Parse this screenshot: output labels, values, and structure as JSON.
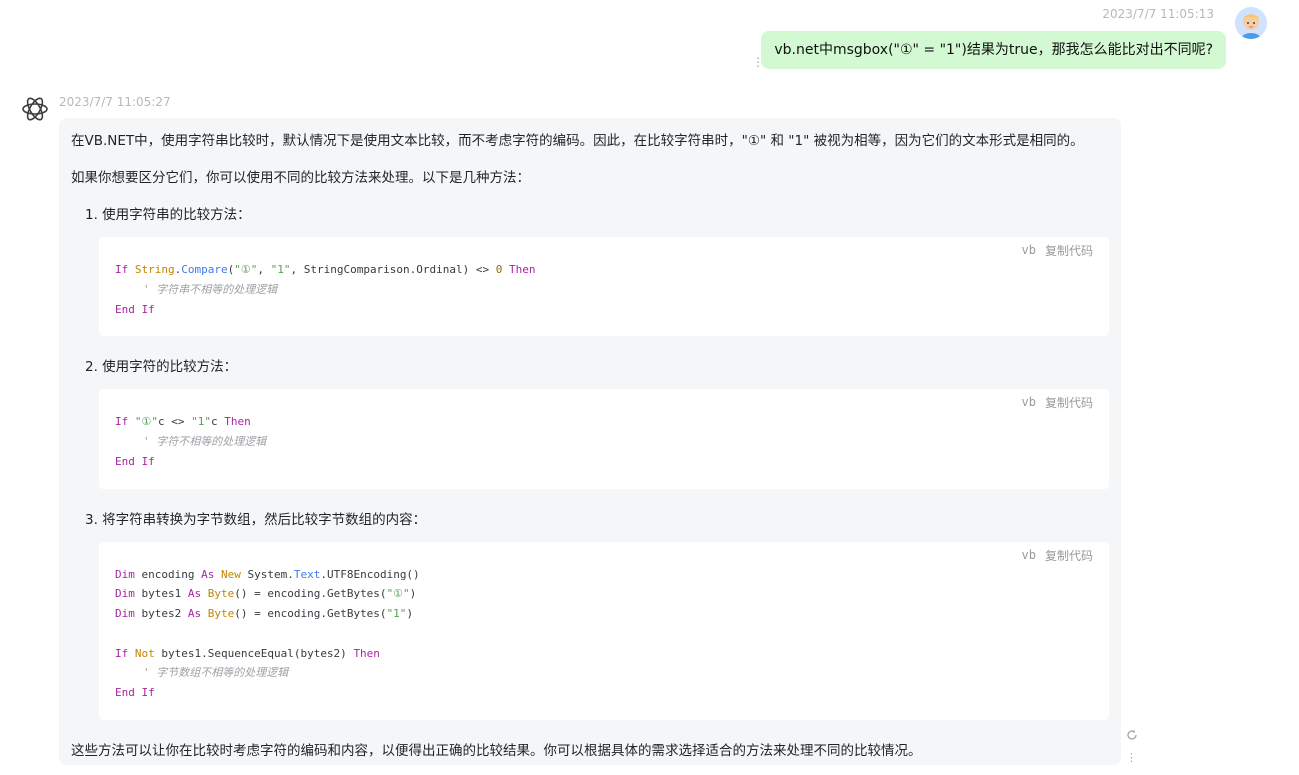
{
  "user_message": {
    "timestamp": "2023/7/7 11:05:13",
    "text": "vb.net中msgbox(\"①\" = \"1\")结果为true，那我怎么能比对出不同呢?"
  },
  "assistant_message": {
    "timestamp": "2023/7/7 11:05:27",
    "intro": "在VB.NET中，使用字符串比较时，默认情况下是使用文本比较，而不考虑字符的编码。因此，在比较字符串时，\"①\" 和 \"1\" 被视为相等，因为它们的文本形式是相同的。",
    "lead": "如果你想要区分它们，你可以使用不同的比较方法来处理。以下是几种方法：",
    "items": [
      "1. 使用字符串的比较方法：",
      "2. 使用字符的比较方法：",
      "3. 将字符串转换为字节数组，然后比较字节数组的内容："
    ],
    "code_lang": "vb",
    "copy_label": "复制代码",
    "code1": {
      "l1_kw": "If",
      "l1_ty": "String",
      "l1_fn": "Compare",
      "l1_a": "(",
      "l1_s1": "\"①\"",
      "l1_b": ", ",
      "l1_s2": "\"1\"",
      "l1_c": ", StringComparison.Ordinal) <> ",
      "l1_n": "0",
      "l1_then": "Then",
      "l2": "' 字符串不相等的处理逻辑",
      "l3": "End If"
    },
    "code2": {
      "l1_kw": "If",
      "l1_s1": "\"①\"",
      "l1_a": "c <> ",
      "l1_s2": "\"1\"",
      "l1_b": "c ",
      "l1_then": "Then",
      "l2": "' 字符不相等的处理逻辑",
      "l3": "End If"
    },
    "code3": {
      "l1_dim": "Dim",
      "l1_a": " encoding ",
      "l1_as": "As",
      "l1_new": "New",
      "l1_b": " System.",
      "l1_text": "Text",
      "l1_c": ".UTF8Encoding()",
      "l2_dim": "Dim",
      "l2_a": " bytes1 ",
      "l2_as": "As",
      "l2_byte": "Byte",
      "l2_b": "() = encoding.GetBytes(",
      "l2_s": "\"①\"",
      "l2_c": ")",
      "l3_dim": "Dim",
      "l3_a": " bytes2 ",
      "l3_as": "As",
      "l3_byte": "Byte",
      "l3_b": "() = encoding.GetBytes(",
      "l3_s": "\"1\"",
      "l3_c": ")",
      "l4_if": "If",
      "l4_not": "Not",
      "l4_a": " bytes1.SequenceEqual(bytes2) ",
      "l4_then": "Then",
      "l5": "' 字节数组不相等的处理逻辑",
      "l6": "End If"
    },
    "outro": "这些方法可以让你在比较时考虑字符的编码和内容，以便得出正确的比较结果。你可以根据具体的需求选择适合的方法来处理不同的比较情况。"
  },
  "colors": {
    "user_bubble": "#d2f9d1",
    "assistant_bubble": "#f4f6f8",
    "keyword": "#a626a4",
    "type": "#c18401",
    "string": "#50a14f",
    "comment": "#a0a1a7"
  },
  "icons": [
    "user-avatar-icon",
    "openai-logo-icon",
    "more-dots-icon",
    "refresh-icon"
  ]
}
